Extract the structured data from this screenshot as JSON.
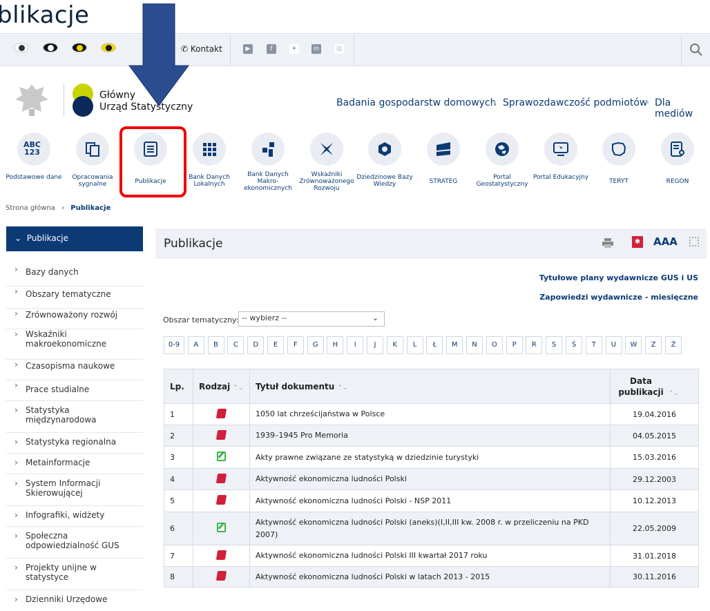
{
  "page_fragment_title": "blikacje",
  "topbar": {
    "contact": "Kontakt"
  },
  "header": {
    "logo_line1": "Główny",
    "logo_line2": "Urząd Statystyczny",
    "nav": [
      "Badania gospodarstw domowych",
      "Sprawozdawczość podmiotów",
      "Dla mediów"
    ]
  },
  "icons": [
    {
      "label": "Podstawowe dane",
      "icon": "abc-123-icon"
    },
    {
      "label": "Opracowania sygnalne",
      "icon": "documents-icon"
    },
    {
      "label": "Publikacje",
      "icon": "publication-icon"
    },
    {
      "label": "Bank Danych Lokalnych",
      "icon": "grid-icon"
    },
    {
      "label": "Bank Danych Makro-ekonomicznych",
      "icon": "blocks-icon"
    },
    {
      "label": "Wskaźniki Zrównoważonego Rozwoju",
      "icon": "cross-icon"
    },
    {
      "label": "Dziedzinowe Bazy Wiedzy",
      "icon": "hexagon-icon"
    },
    {
      "label": "STRATEG",
      "icon": "strateg-icon"
    },
    {
      "label": "Portal Geostatystyczny",
      "icon": "geo-icon"
    },
    {
      "label": "Portal Edukacyjny",
      "icon": "edu-icon"
    },
    {
      "label": "TERYT",
      "icon": "map-icon"
    },
    {
      "label": "REGON",
      "icon": "regon-icon"
    }
  ],
  "breadcrumb": {
    "home": "Strona główna",
    "current": "Publikacje"
  },
  "sidebar": {
    "header": "Publikacje",
    "items": [
      "Bazy danych",
      "Obszary tematyczne",
      "Zrównoważony rozwój",
      "Wskaźniki makroekonomiczne",
      "Czasopisma naukowe",
      "Prace studialne",
      "Statystyka międzynarodowa",
      "Statystyka regionalna",
      "Metainformacje",
      "System Informacji Skierowującej",
      "Infografiki, widżety",
      "Społeczna odpowiedzialność GUS",
      "Projekty unijne w statystyce",
      "Dzienniki Urzędowe"
    ]
  },
  "main": {
    "title": "Publikacje",
    "font_size_label": "AAA",
    "link1": "Tytułowe plany wydawnicze GUS i US",
    "link2": "Zapowiedzi wydawnicze - miesięczne",
    "filter_label": "Obszar tematyczny:",
    "filter_value": "-- wybierz --",
    "letters": [
      "0-9",
      "A",
      "B",
      "C",
      "D",
      "E",
      "F",
      "G",
      "H",
      "I",
      "J",
      "K",
      "L",
      "Ł",
      "M",
      "N",
      "O",
      "P",
      "R",
      "S",
      "Ś",
      "T",
      "U",
      "W",
      "Z",
      "Ż"
    ]
  },
  "table": {
    "headers": {
      "lp": "Lp.",
      "rodzaj": "Rodzaj",
      "title": "Tytuł dokumentu",
      "date": "Data publikacji"
    },
    "rows": [
      {
        "lp": "1",
        "type": "book",
        "title": "1050 lat chrześcijaństwa w Polsce",
        "date": "19.04.2016"
      },
      {
        "lp": "2",
        "type": "book",
        "title": "1939–1945 Pro Memoria",
        "date": "04.05.2015"
      },
      {
        "lp": "3",
        "type": "edit",
        "title": "Akty prawne związane ze statystyką w dziedzinie turystyki",
        "date": "15.03.2016"
      },
      {
        "lp": "4",
        "type": "book",
        "title": "Aktywność ekonomiczna ludności Polski",
        "date": "29.12.2003"
      },
      {
        "lp": "5",
        "type": "book",
        "title": "Aktywność ekonomiczna ludności Polski - NSP 2011",
        "date": "10.12.2013"
      },
      {
        "lp": "6",
        "type": "edit",
        "title": "Aktywność ekonomiczna ludności Polski (aneks)(I,II,III kw. 2008 r. w przeliczeniu na PKD 2007)",
        "date": "22.05.2009"
      },
      {
        "lp": "7",
        "type": "book",
        "title": "Aktywność ekonomiczna ludności Polski III kwartał 2017 roku",
        "date": "31.01.2018"
      },
      {
        "lp": "8",
        "type": "book",
        "title": "Aktywność ekonomiczna ludności Polski w latach 2013 - 2015",
        "date": "30.11.2016"
      }
    ]
  },
  "colors": {
    "brand": "#0b3a75",
    "highlight": "#e00000",
    "arrow": "#2a4d8f"
  }
}
